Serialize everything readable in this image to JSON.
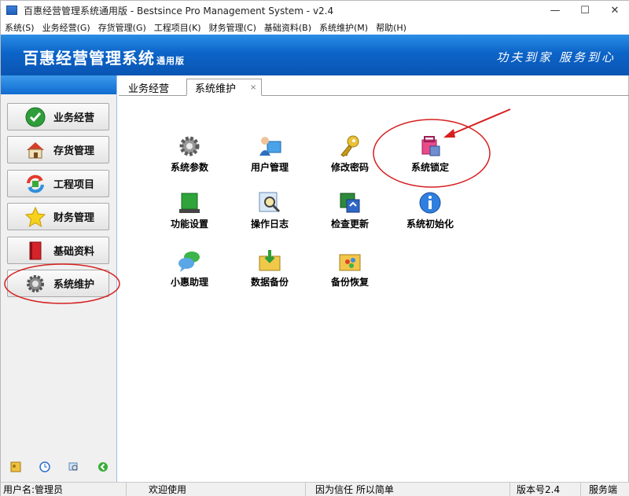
{
  "window": {
    "title": "百惠经营管理系统通用版 - Bestsince Pro Management System - v2.4",
    "controls": [
      "—",
      "☐",
      "✕"
    ]
  },
  "menu": [
    "系统(S)",
    "业务经营(G)",
    "存货管理(G)",
    "工程项目(K)",
    "财务管理(C)",
    "基础资料(B)",
    "系统维护(M)",
    "帮助(H)"
  ],
  "banner": {
    "title": "百惠经营管理系统",
    "subtitle": "通用版",
    "slogan": "功夫到家 服务到心"
  },
  "sidebar": {
    "items": [
      {
        "label": "业务经营",
        "icon": "check-icon"
      },
      {
        "label": "存货管理",
        "icon": "house-icon"
      },
      {
        "label": "工程项目",
        "icon": "refresh-arrows-icon"
      },
      {
        "label": "财务管理",
        "icon": "star-icon"
      },
      {
        "label": "基础资料",
        "icon": "book-icon"
      },
      {
        "label": "系统维护",
        "icon": "gear-icon"
      }
    ],
    "bottom_icons": [
      "key-icon",
      "clock-icon",
      "search-icon",
      "back-arrow-icon"
    ]
  },
  "tabs": [
    {
      "label": "业务经营",
      "active": false
    },
    {
      "label": "系统维护",
      "active": true,
      "close": "×"
    }
  ],
  "tools": [
    {
      "label": "系统参数",
      "icon": "gear-icon"
    },
    {
      "label": "用户管理",
      "icon": "user-icon"
    },
    {
      "label": "修改密码",
      "icon": "key-icon"
    },
    {
      "label": "系统锁定",
      "icon": "lock-icon"
    },
    {
      "label": "功能设置",
      "icon": "green-box-icon"
    },
    {
      "label": "操作日志",
      "icon": "magnifier-log-icon"
    },
    {
      "label": "检查更新",
      "icon": "update-icon"
    },
    {
      "label": "系统初始化",
      "icon": "info-icon"
    },
    {
      "label": "小惠助理",
      "icon": "chat-bubble-icon"
    },
    {
      "label": "数据备份",
      "icon": "backup-folder-icon"
    },
    {
      "label": "备份恢复",
      "icon": "restore-folder-icon"
    }
  ],
  "status": {
    "user": "用户名:管理员",
    "welcome": "欢迎使用",
    "motto": "因为信任 所以简单",
    "version": "版本号2.4",
    "side": "服务端"
  },
  "colors": {
    "banner": "#0c64c8",
    "annotation": "#d62020"
  }
}
